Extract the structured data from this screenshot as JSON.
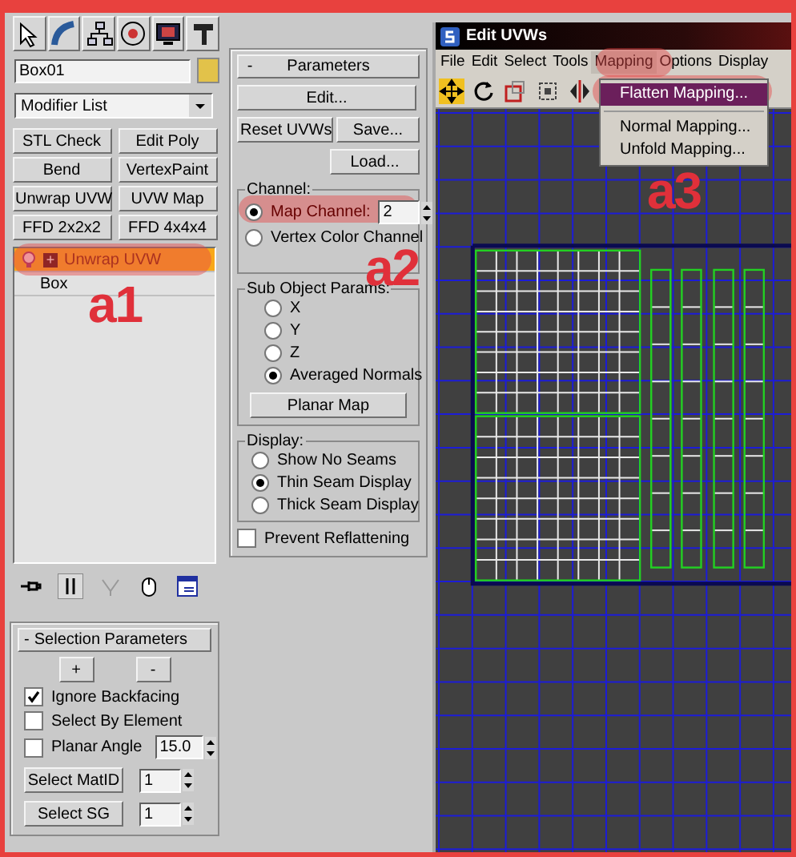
{
  "modify_panel": {
    "object_name": "Box01",
    "modifier_list": "Modifier List",
    "modifier_buttons": [
      "STL Check",
      "Edit Poly",
      "Bend",
      "VertexPaint",
      "Unwrap UVW",
      "UVW Map",
      "FFD 2x2x2",
      "FFD 4x4x4"
    ],
    "stack": [
      {
        "kind": "modifier",
        "label": "Unwrap UVW",
        "selected": true,
        "highlighted": true,
        "expand_sign": "+"
      },
      {
        "kind": "base",
        "label": "Box",
        "selected": false,
        "highlighted": false
      }
    ]
  },
  "selection_parameters": {
    "collapse_sign": "-",
    "title": "Selection Parameters",
    "grow_button": "+",
    "shrink_button": "-",
    "checkboxes": [
      {
        "label": "Ignore Backfacing",
        "checked": true
      },
      {
        "label": "Select By Element",
        "checked": false
      },
      {
        "label": "Planar Angle",
        "checked": false,
        "value": "15.0"
      }
    ],
    "select_matid": {
      "label": "Select MatID",
      "value": "1"
    },
    "select_sg": {
      "label": "Select SG",
      "value": "1"
    }
  },
  "parameters": {
    "collapse_sign": "-",
    "title": "Parameters",
    "edit_button": "Edit...",
    "reset_button": "Reset UVWs",
    "save_button": "Save...",
    "load_button": "Load...",
    "channel": {
      "title": "Channel:",
      "options": [
        {
          "label": "Map Channel:",
          "selected": true,
          "highlighted": true,
          "value": "2"
        },
        {
          "label": "Vertex Color Channel",
          "selected": false,
          "highlighted": false
        }
      ]
    },
    "sub_object": {
      "title": "Sub Object Params:",
      "options": [
        {
          "label": "X",
          "selected": false
        },
        {
          "label": "Y",
          "selected": false
        },
        {
          "label": "Z",
          "selected": false
        },
        {
          "label": "Averaged Normals",
          "selected": true
        }
      ],
      "button": "Planar Map"
    },
    "display": {
      "title": "Display:",
      "options": [
        {
          "label": "Show No Seams",
          "selected": false
        },
        {
          "label": "Thin Seam Display",
          "selected": true
        },
        {
          "label": "Thick Seam Display",
          "selected": false
        }
      ]
    },
    "prevent_reflattening": {
      "label": "Prevent Reflattening",
      "checked": false
    }
  },
  "uv_editor": {
    "title": "Edit UVWs",
    "menu": [
      {
        "label": "File",
        "open": false,
        "highlighted": false
      },
      {
        "label": "Edit",
        "open": false,
        "highlighted": false
      },
      {
        "label": "Select",
        "open": false,
        "highlighted": false
      },
      {
        "label": "Tools",
        "open": false,
        "highlighted": false
      },
      {
        "label": "Mapping",
        "open": true,
        "highlighted": true
      },
      {
        "label": "Options",
        "open": false,
        "highlighted": false
      },
      {
        "label": "Display",
        "open": false,
        "highlighted": false
      }
    ],
    "mapping_menu": [
      {
        "label": "Flatten Mapping...",
        "selected": true,
        "highlighted": true
      },
      {
        "label": "Normal Mapping...",
        "selected": false,
        "highlighted": false
      },
      {
        "label": "Unfold Mapping...",
        "selected": false,
        "highlighted": false
      }
    ]
  },
  "annotations": [
    "a1",
    "a2",
    "a3"
  ]
}
